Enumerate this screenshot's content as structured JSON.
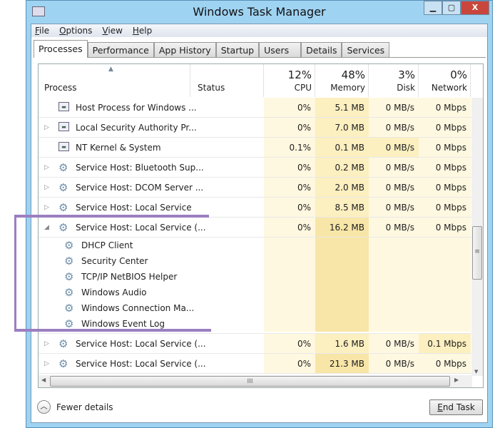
{
  "window": {
    "title": "Windows Task Manager",
    "minimize": "▁",
    "maximize": "▢",
    "close": "X"
  },
  "menu": [
    "File",
    "Options",
    "View",
    "Help"
  ],
  "tabs": [
    "Processes",
    "Performance",
    "App History",
    "Startup",
    "Users",
    "Details",
    "Services"
  ],
  "columns": {
    "process": "Process",
    "status": "Status",
    "cpu": {
      "pct": "12%",
      "label": "CPU"
    },
    "memory": {
      "pct": "48%",
      "label": "Memory"
    },
    "disk": {
      "pct": "3%",
      "label": "Disk"
    },
    "network": {
      "pct": "0%",
      "label": "Network"
    }
  },
  "rows": [
    {
      "name": "Host Process for Windows ...",
      "icon": "window",
      "expand": "",
      "cpu": "0%",
      "mem": "5.1 MB",
      "disk": "0 MB/s",
      "net": "0 Mbps",
      "heat": [
        0,
        1,
        0,
        0
      ]
    },
    {
      "name": "Local Security Authority Pr...",
      "icon": "window",
      "expand": "▷",
      "cpu": "0%",
      "mem": "7.0 MB",
      "disk": "0 MB/s",
      "net": "0 Mbps",
      "heat": [
        0,
        1,
        0,
        0
      ]
    },
    {
      "name": "NT Kernel & System",
      "icon": "window",
      "expand": "",
      "cpu": "0.1%",
      "mem": "0.1 MB",
      "disk": "0 MB/s",
      "net": "0 Mbps",
      "heat": [
        0,
        1,
        1,
        0
      ]
    },
    {
      "name": "Service Host: Bluetooth Sup...",
      "icon": "gear",
      "expand": "▷",
      "cpu": "0%",
      "mem": "0.2 MB",
      "disk": "0 MB/s",
      "net": "0 Mbps",
      "heat": [
        0,
        1,
        0,
        0
      ]
    },
    {
      "name": "Service Host: DCOM Server ...",
      "icon": "gear",
      "expand": "▷",
      "cpu": "0%",
      "mem": "2.0 MB",
      "disk": "0 MB/s",
      "net": "0 Mbps",
      "heat": [
        0,
        1,
        0,
        0
      ]
    },
    {
      "name": "Service Host: Local Service",
      "icon": "gear",
      "expand": "▷",
      "cpu": "0%",
      "mem": "8.5 MB",
      "disk": "0 MB/s",
      "net": "0 Mbps",
      "heat": [
        0,
        1,
        0,
        0
      ]
    },
    {
      "name": "Service Host: Local Service (...",
      "icon": "gear",
      "expand": "◢",
      "cpu": "0%",
      "mem": "16.2 MB",
      "disk": "0 MB/s",
      "net": "0 Mbps",
      "heat": [
        0,
        2,
        0,
        0
      ],
      "children": [
        "DHCP Client",
        "Security Center",
        "TCP/IP NetBIOS Helper",
        "Windows Audio",
        "Windows Connection Ma...",
        "Windows Event Log"
      ]
    },
    {
      "name": "Service Host: Local Service (...",
      "icon": "gear",
      "expand": "▷",
      "cpu": "0%",
      "mem": "1.6 MB",
      "disk": "0 MB/s",
      "net": "0.1 Mbps",
      "heat": [
        0,
        1,
        0,
        1
      ]
    },
    {
      "name": "Service Host: Local Service (...",
      "icon": "gear",
      "expand": "▷",
      "cpu": "0%",
      "mem": "21.3 MB",
      "disk": "0 MB/s",
      "net": "0 Mbps",
      "heat": [
        0,
        2,
        0,
        0
      ]
    }
  ],
  "footer": {
    "fewer_details": "Fewer details",
    "end_task": "End Task"
  }
}
